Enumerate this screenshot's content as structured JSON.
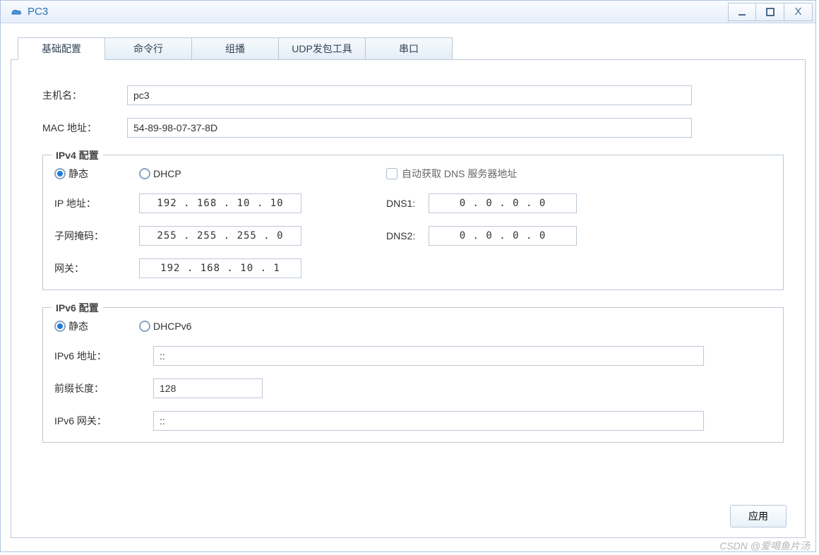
{
  "window": {
    "title": "PC3"
  },
  "tabs": {
    "items": [
      {
        "label": "基础配置",
        "active": true
      },
      {
        "label": "命令行",
        "active": false
      },
      {
        "label": "组播",
        "active": false
      },
      {
        "label": "UDP发包工具",
        "active": false
      },
      {
        "label": "串口",
        "active": false
      }
    ]
  },
  "basic": {
    "hostname_label": "主机名：",
    "hostname_value": "pc3",
    "mac_label": "MAC 地址：",
    "mac_value": "54-89-98-07-37-8D"
  },
  "ipv4": {
    "legend": "IPv4 配置",
    "static_label": "静态",
    "dhcp_label": "DHCP",
    "mode": "static",
    "autodns_label": "自动获取 DNS 服务器地址",
    "autodns_checked": false,
    "ip_label": "IP 地址：",
    "ip_value": "192  .  168  .  10  .  10",
    "mask_label": "子网掩码：",
    "mask_value": "255  .  255  .  255  .  0",
    "gw_label": "网关：",
    "gw_value": "192  .  168  .  10  .  1",
    "dns1_label": "DNS1:",
    "dns1_value": "0  .  0  .  0  .  0",
    "dns2_label": "DNS2:",
    "dns2_value": "0  .  0  .  0  .  0"
  },
  "ipv6": {
    "legend": "IPv6 配置",
    "static_label": "静态",
    "dhcp_label": "DHCPv6",
    "mode": "static",
    "addr_label": "IPv6 地址：",
    "addr_value": "::",
    "prefix_label": "前缀长度：",
    "prefix_value": "128",
    "gw_label": "IPv6 网关：",
    "gw_value": "::"
  },
  "buttons": {
    "apply": "应用"
  },
  "watermark": "CSDN @爱喝鱼片汤"
}
